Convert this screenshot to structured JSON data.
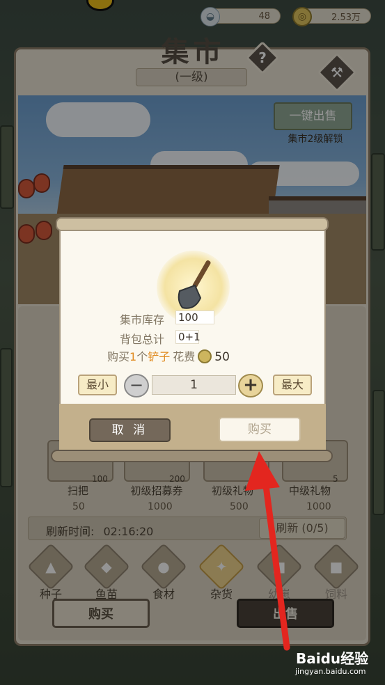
{
  "resources": {
    "bowl": {
      "icon": "bowl-icon",
      "value": "48"
    },
    "coins": {
      "icon": "coin-icon",
      "value": "2.53万"
    }
  },
  "header": {
    "title": "集市",
    "level": "(一级)",
    "help_icon": "question-icon",
    "hammer_icon": "hammer-icon"
  },
  "scene": {
    "sell_all_label": "一键出售",
    "unlock_note": "集市2级解锁",
    "side_tag": "杂货"
  },
  "shelf": {
    "items": [
      {
        "name": "扫把",
        "count": "100",
        "price": "50"
      },
      {
        "name": "初级招募券",
        "count": "200",
        "price": "1000"
      },
      {
        "name": "初级礼物",
        "count": "",
        "price": "500"
      },
      {
        "name": "中级礼物",
        "count": "5",
        "price": "1000"
      }
    ],
    "refresh_label": "刷新时间:",
    "refresh_time": "02:16:20",
    "refresh_button": "刷新 (0/5)"
  },
  "categories": [
    {
      "label": "种子",
      "icon": "seed-bag-icon",
      "locked": false,
      "active": false
    },
    {
      "label": "鱼苗",
      "icon": "fish-icon",
      "locked": false,
      "active": false
    },
    {
      "label": "食材",
      "icon": "teapot-icon",
      "locked": false,
      "active": false
    },
    {
      "label": "杂货",
      "icon": "tool-icon",
      "locked": false,
      "active": true
    },
    {
      "label": "幼崽",
      "icon": "lock-icon",
      "locked": true,
      "active": false
    },
    {
      "label": "饲料",
      "icon": "lock-icon",
      "locked": true,
      "active": false
    }
  ],
  "bottom": {
    "buy_label": "购买",
    "sell_label": "出售"
  },
  "popup": {
    "item_icon": "shovel-icon",
    "stock_label": "集市库存",
    "stock_value": "100",
    "bag_label": "背包总计",
    "bag_value": "0+1",
    "buy_prefix": "购买",
    "buy_qty": "1",
    "buy_unit": "个",
    "buy_item": "铲子",
    "cost_label": "花费",
    "cost_value": "50",
    "min_label": "最小",
    "max_label": "最大",
    "quantity": "1",
    "cancel_label": "取 消",
    "confirm_label": "购买"
  },
  "watermark": {
    "brand": "Baidu经验",
    "url": "jingyan.baidu.com"
  }
}
